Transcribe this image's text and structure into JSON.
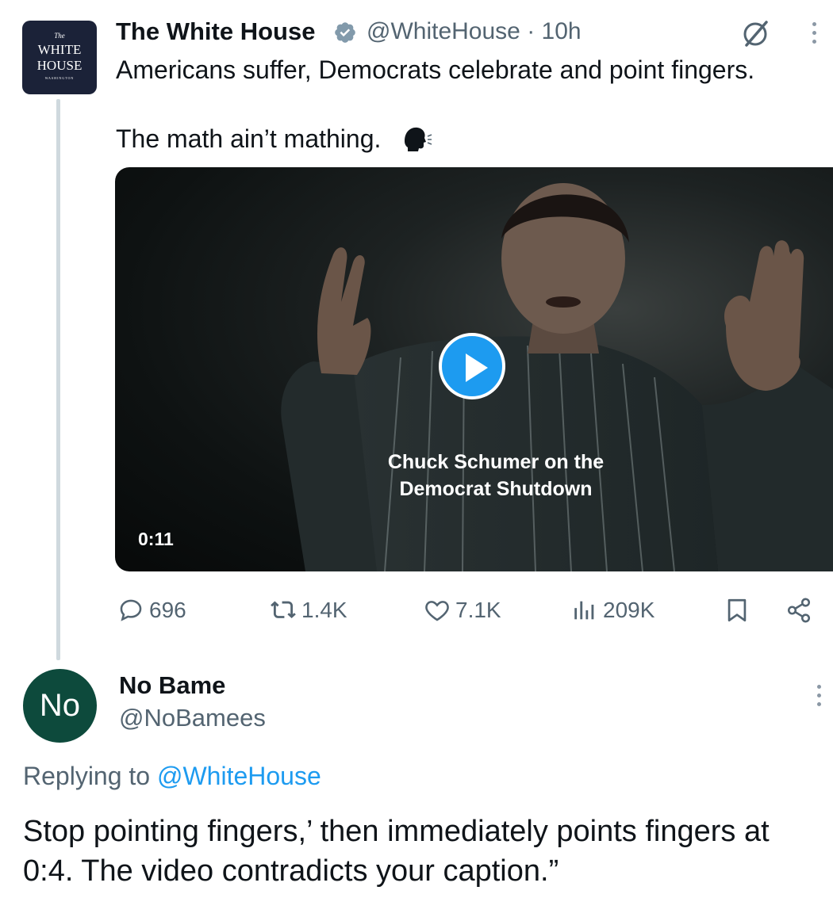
{
  "tweet": {
    "avatar": {
      "line1": "The",
      "line2": "WHITE",
      "line3": "HOUSE",
      "line4": "WASHINGTON"
    },
    "author_name": "The White House",
    "verified_icon": "verified-badge-icon",
    "handle_time": "@WhiteHouse · 10h",
    "text_line1": "Americans suffer, Democrats celebrate and point fingers.",
    "text_line2": "The math ain’t mathing.",
    "media": {
      "caption_line1": "Chuck Schumer on the",
      "caption_line2": "Democrat Shutdown",
      "duration": "0:11"
    },
    "actions": {
      "replies": "696",
      "reposts": "1.4K",
      "likes": "7.1K",
      "views": "209K"
    }
  },
  "reply": {
    "avatar_text": "No",
    "author_name": "No Bame",
    "handle": "@NoBamees",
    "replying_prefix": "Replying to ",
    "replying_to": "@WhiteHouse",
    "text": "Stop pointing fingers,’ then immediately points fingers at 0:4. The video contradicts your caption.”"
  },
  "colors": {
    "accent": "#1d9bf0",
    "muted": "#536471",
    "reply_avatar_bg": "#0d4a3c",
    "wh_avatar_bg": "#1b2238"
  }
}
